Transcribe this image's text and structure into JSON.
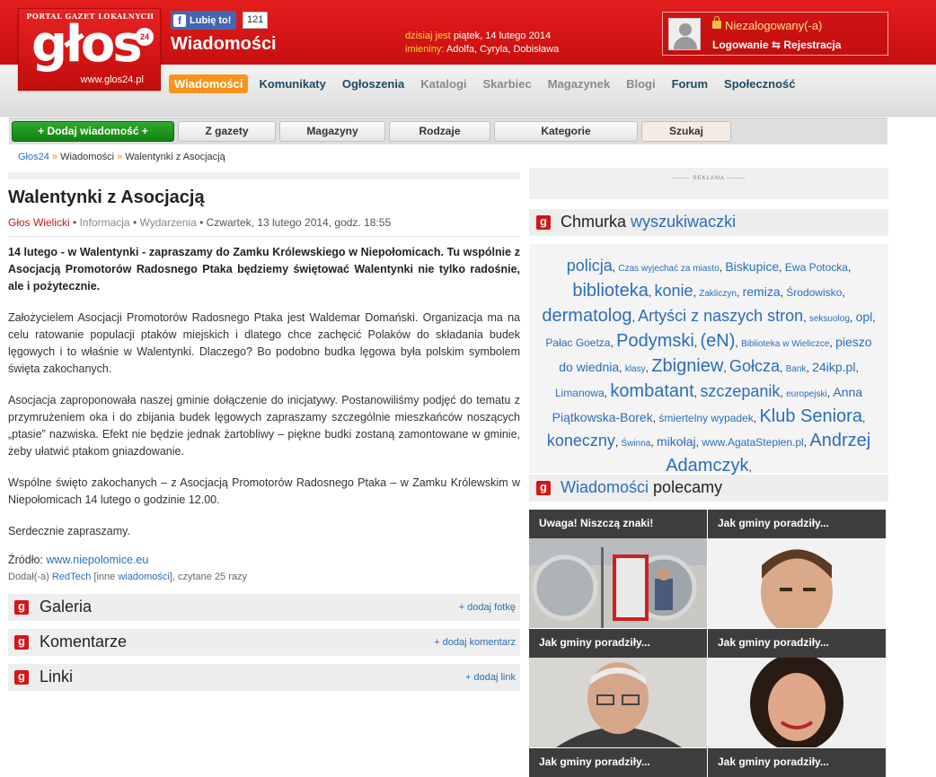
{
  "header": {
    "logo_tagline": "PORTAL GAZET LOKALNYCH",
    "logo_word": "głos",
    "logo_badge": "24",
    "logo_url": "www.glos24.pl",
    "fb_like": "Lubię to!",
    "fb_count": "121",
    "section_title": "Wiadomości",
    "date_label": "dzisiaj jest",
    "date_value": "piątek, 14 lutego 2014",
    "nameday_label": "imieniny:",
    "nameday_value": "Adolfa, Cyryla, Dobisława",
    "login_status": "Niezalogowany(-a)",
    "login_links": "Logowanie ⇆ Rejestracja"
  },
  "nav": {
    "items": [
      {
        "label": "Wiadomości",
        "state": "active"
      },
      {
        "label": "Komunikaty",
        "state": "normal"
      },
      {
        "label": "Ogłoszenia",
        "state": "normal"
      },
      {
        "label": "Katalogi",
        "state": "dim"
      },
      {
        "label": "Skarbiec",
        "state": "dim"
      },
      {
        "label": "Magazynek",
        "state": "dim"
      },
      {
        "label": "Blogi",
        "state": "dim"
      },
      {
        "label": "Forum",
        "state": "normal"
      },
      {
        "label": "Społeczność",
        "state": "normal"
      }
    ]
  },
  "subnav": {
    "add": "+ Dodaj wiadomość +",
    "items": [
      "Z gazety",
      "Magazyny",
      "Rodzaje",
      "Kategorie",
      "Szukaj"
    ]
  },
  "breadcrumb": {
    "items": [
      "Głos24",
      "Wiadomości",
      "Walentynki z Asocjacją"
    ],
    "separator": "»"
  },
  "article": {
    "title": "Walentynki z Asocjacją",
    "author": "Głos Wielicki",
    "category1": "Informacja",
    "category2": "Wydarzenia",
    "date": "Czwartek, 13 lutego 2014, godz. 18:55",
    "lead": "14 lutego - w Walentynki - zapraszamy do Zamku Królewskiego w Niepołomicach. Tu wspólnie z Asocjacją Promotorów Radosnego Ptaka będziemy świętować Walentynki nie tylko radośnie, ale i pożytecznie.",
    "paragraphs": [
      "Założycielem Asocjacji Promotorów Radosnego Ptaka jest Waldemar Domański. Organizacja ma na celu ratowanie populacji ptaków miejskich i dlatego chce zachęcić Polaków do składania budek lęgowych i to właśnie w Walentynki. Dlaczego? Bo podobno budka lęgowa była polskim symbolem święta zakochanych.",
      "Asocjacja zaproponowała naszej gminie dołączenie do inicjatywy. Postanowiliśmy podjęć do tematu z przymrużeniem oka i do zbijania budek lęgowych zapraszamy szczególnie mieszkańców noszących „ptasie” nazwiska. Efekt nie będzie jednak żartobliwy – piękne budki zostaną zamontowane w gminie, żeby ułatwić ptakom gniazdowanie.",
      "Wspólne święto zakochanych – z Asocjacją Promotorów Radosnego Ptaka – w Zamku Królewskim w Niepołomicach 14 lutego o godzinie 12.00.",
      "Serdecznie zapraszamy."
    ],
    "source_label": "Źródło:",
    "source_link": "www.niepolomice.eu",
    "added_label": "Dodał(-a)",
    "added_user": "RedTech",
    "added_other_pre": "[inne",
    "added_other_link": "wiadomości",
    "added_other_post": "], czytane 25 razy"
  },
  "boxes": [
    {
      "title": "Galeria",
      "action": "+ dodaj fotkę"
    },
    {
      "title": "Komentarze",
      "action": "+ dodaj komentarz"
    },
    {
      "title": "Linki",
      "action": "+ dodaj link"
    }
  ],
  "sidebar": {
    "ad_label": "——— REKLAMA ———",
    "cloud_title_a": "Chmurka",
    "cloud_title_b": "wyszukiwaczki",
    "tags": [
      {
        "text": "policja",
        "size": 4
      },
      {
        "text": "Czas wyjechać za miasto",
        "size": 1
      },
      {
        "text": "Biskupice",
        "size": 3
      },
      {
        "text": "Ewa Potocka",
        "size": 2
      },
      {
        "text": "biblioteka",
        "size": 5
      },
      {
        "text": "konie",
        "size": 4
      },
      {
        "text": "Zakliczyn",
        "size": 1
      },
      {
        "text": "remiza",
        "size": 3
      },
      {
        "text": "Środowisko",
        "size": 2
      },
      {
        "text": "dermatolog",
        "size": 5
      },
      {
        "text": "Artyści z naszych stron",
        "size": 4
      },
      {
        "text": "seksuolog",
        "size": 1
      },
      {
        "text": "opl",
        "size": 3
      },
      {
        "text": "Pałac Goetza",
        "size": 2
      },
      {
        "text": "Podymski",
        "size": 5
      },
      {
        "text": "(eN)",
        "size": 5
      },
      {
        "text": "Biblioteka w Wieliczce",
        "size": 1
      },
      {
        "text": "pieszo do wiednia",
        "size": 3
      },
      {
        "text": "klasy",
        "size": 1
      },
      {
        "text": "Zbigniew",
        "size": 5
      },
      {
        "text": "Gołcza",
        "size": 4
      },
      {
        "text": "Bank",
        "size": 1
      },
      {
        "text": "24ikp.pl",
        "size": 3
      },
      {
        "text": "Limanowa",
        "size": 2
      },
      {
        "text": "kombatant",
        "size": 5
      },
      {
        "text": "szczepanik",
        "size": 4
      },
      {
        "text": "europejski",
        "size": 1
      },
      {
        "text": "Anna Piątkowska-Borek",
        "size": 3
      },
      {
        "text": "śmiertelny wypadek",
        "size": 2
      },
      {
        "text": "Klub Seniora",
        "size": 5
      },
      {
        "text": "koneczny",
        "size": 4
      },
      {
        "text": "Świnna",
        "size": 1
      },
      {
        "text": "mikołaj",
        "size": 3
      },
      {
        "text": "www.AgataStepien.pl",
        "size": 2
      },
      {
        "text": "Andrzej Adamczyk",
        "size": 5
      }
    ],
    "rec_title_a": "Wiadomości",
    "rec_title_b": "polecamy",
    "recommended": [
      {
        "caption": "Uwaga! Niszczą znaki!",
        "image": "road-mirrors"
      },
      {
        "caption": "Jak gminy poradziły...",
        "image": "man-portrait"
      },
      {
        "caption": "Jak gminy poradziły...",
        "image": "man-glasses"
      },
      {
        "caption": "Jak gminy poradziły...",
        "image": "woman-portrait"
      },
      {
        "caption": "Jak gminy poradziły...",
        "image": ""
      },
      {
        "caption": "Jak gminy poradziły...",
        "image": ""
      }
    ]
  },
  "colors": {
    "brand_red": "#d71515",
    "nav_active": "#f7941d",
    "link_blue": "#2a6ebb",
    "add_green": "#1e991e"
  }
}
